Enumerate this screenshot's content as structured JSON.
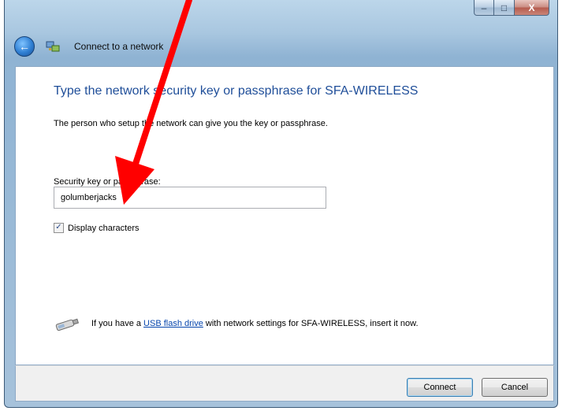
{
  "window": {
    "nav_title": "Connect to a network",
    "caption_min": "–",
    "caption_max": "□",
    "caption_close": "X"
  },
  "dialog": {
    "heading": "Type the network security key or passphrase for SFA-WIRELESS",
    "description": "The person who setup the network can give you the key or passphrase.",
    "field_label": "Security key or passphrase:",
    "field_value": "golumberjacks",
    "checkbox_label": "Display characters",
    "checkbox_checked": true,
    "usb_text_before": "If you have a ",
    "usb_link": "USB flash drive",
    "usb_text_after": " with network settings for SFA-WIRELESS, insert it now."
  },
  "buttons": {
    "connect": "Connect",
    "cancel": "Cancel"
  },
  "colors": {
    "heading": "#1f4e99",
    "annotation_arrow": "#ff0000"
  }
}
